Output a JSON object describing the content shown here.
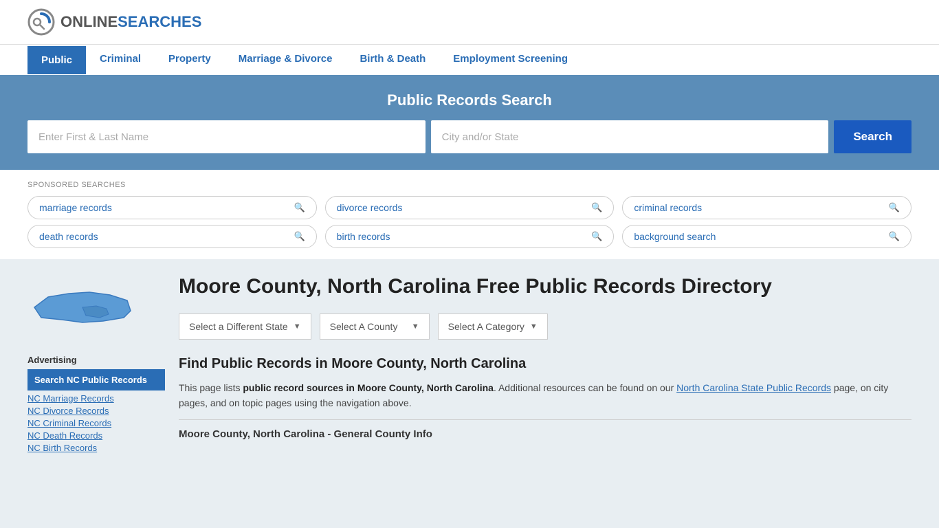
{
  "header": {
    "logo_online": "ONLINE",
    "logo_searches": "SEARCHES"
  },
  "nav": {
    "items": [
      {
        "label": "Public",
        "active": true
      },
      {
        "label": "Criminal",
        "active": false
      },
      {
        "label": "Property",
        "active": false
      },
      {
        "label": "Marriage & Divorce",
        "active": false
      },
      {
        "label": "Birth & Death",
        "active": false
      },
      {
        "label": "Employment Screening",
        "active": false
      }
    ]
  },
  "search_banner": {
    "title": "Public Records Search",
    "name_placeholder": "Enter First & Last Name",
    "location_placeholder": "City and/or State",
    "button_label": "Search"
  },
  "sponsored": {
    "label": "SPONSORED SEARCHES",
    "links": [
      "marriage records",
      "divorce records",
      "criminal records",
      "death records",
      "birth records",
      "background search"
    ]
  },
  "page": {
    "title": "Moore County, North Carolina Free Public Records Directory",
    "selectors": {
      "state": "Select a Different State",
      "county": "Select A County",
      "category": "Select A Category"
    },
    "section_title": "Find Public Records in Moore County, North Carolina",
    "description_part1": "This page lists ",
    "description_bold": "public record sources in Moore County, North Carolina",
    "description_part2": ". Additional resources can be found on our ",
    "description_link": "North Carolina State Public Records",
    "description_part3": " page, on city pages, and on topic pages using the navigation above.",
    "county_info_title": "Moore County, North Carolina - General County Info"
  },
  "sidebar": {
    "advertising_label": "Advertising",
    "ad_highlight": "Search NC Public Records",
    "links": [
      "NC Marriage Records",
      "NC Divorce Records",
      "NC Criminal Records",
      "NC Death Records",
      "NC Birth Records"
    ]
  }
}
